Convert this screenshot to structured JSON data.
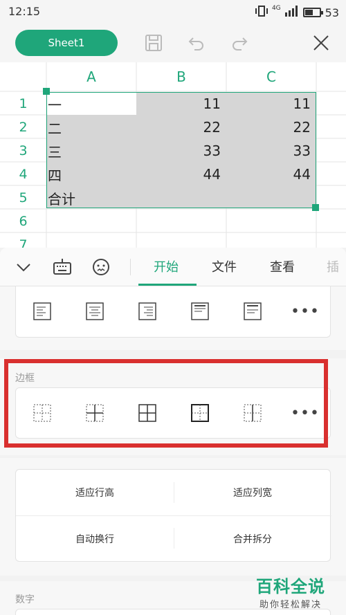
{
  "status": {
    "time": "12:15",
    "network": "4G",
    "battery": "53",
    "battery_level": 0.53
  },
  "toolbar": {
    "sheet_label": "Sheet1"
  },
  "grid": {
    "columns": [
      "A",
      "B",
      "C"
    ],
    "rows": [
      "1",
      "2",
      "3",
      "4",
      "5",
      "6",
      "7"
    ],
    "cells": [
      [
        "一",
        "11",
        "11"
      ],
      [
        "二",
        "22",
        "22"
      ],
      [
        "三",
        "33",
        "33"
      ],
      [
        "四",
        "44",
        "44"
      ],
      [
        "合计",
        "",
        ""
      ]
    ]
  },
  "tabs": {
    "start": "开始",
    "file": "文件",
    "view": "查看",
    "insert": "插"
  },
  "border_section": {
    "label": "边框"
  },
  "commands": {
    "fit_row": "适应行高",
    "fit_col": "适应列宽",
    "wrap": "自动换行",
    "merge": "合并拆分"
  },
  "number_section": {
    "label": "数字"
  },
  "watermark": {
    "title": "百科全说",
    "subtitle": "助你轻松解决"
  },
  "colors": {
    "accent": "#1fa67a",
    "highlight": "#d9302f"
  }
}
